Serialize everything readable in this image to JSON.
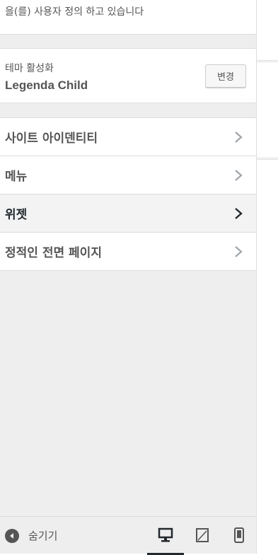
{
  "header": {
    "info_text": "을(를) 사용자 정의 하고 있습니다"
  },
  "theme": {
    "label": "테마 활성화",
    "name": "Legenda Child",
    "change_button": "변경"
  },
  "sections": [
    {
      "title": "사이트 아이덴티티",
      "active": false
    },
    {
      "title": "메뉴",
      "active": false
    },
    {
      "title": "위젯",
      "active": true
    },
    {
      "title": "정적인 전면 페이지",
      "active": false
    }
  ],
  "footer": {
    "collapse_label": "숨기기",
    "devices": [
      {
        "name": "desktop",
        "icon": "desktop-icon",
        "active": true
      },
      {
        "name": "tablet",
        "icon": "tablet-icon",
        "active": false
      },
      {
        "name": "mobile",
        "icon": "mobile-icon",
        "active": false
      }
    ]
  },
  "colors": {
    "panel_bg": "#eeeeee",
    "text": "#555555",
    "active_text": "#23282d",
    "border": "#dddddd"
  }
}
